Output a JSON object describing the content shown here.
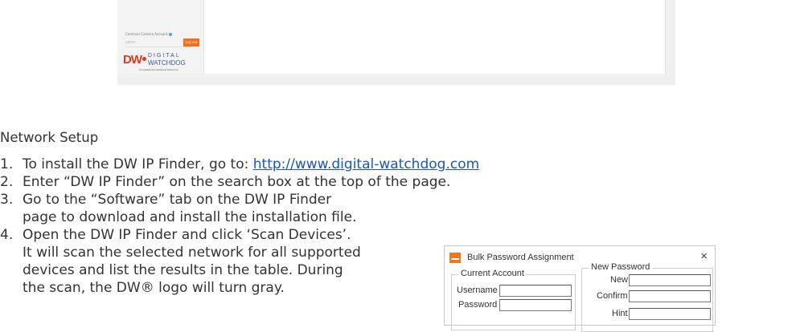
{
  "embedded_screenshot": {
    "common_camera_account_label": "Common Camera Account",
    "input_text": "admin",
    "button_label": "Log out",
    "logo": {
      "mark": "DW",
      "line1": "DIGITAL",
      "line2": "WATCHDOG",
      "tagline": "Complete Surveillance Solutions"
    }
  },
  "document": {
    "heading": "Network Setup",
    "steps": [
      {
        "num": "1.",
        "text": "To install the DW IP Finder, go to: ",
        "link": "http://www.digital-watchdog.com"
      },
      {
        "num": "2.",
        "text": "Enter “DW IP Finder” on the search box at the top of the page."
      },
      {
        "num": "3.",
        "lines": [
          "Go to the “Software” tab on the DW IP Finder",
          "page to download and install the installation file."
        ]
      },
      {
        "num": "4.",
        "lines": [
          "Open the DW IP Finder and click ‘Scan Devices’.",
          "It will scan the selected network for all supported",
          "devices and list the results in the table. During",
          "the scan, the DW® logo will turn gray."
        ]
      }
    ]
  },
  "dialog": {
    "title": "Bulk Password Assignment",
    "close_icon": "close-icon",
    "current_account": {
      "legend": "Current Account",
      "username_label": "Username",
      "password_label": "Password"
    },
    "new_password": {
      "legend": "New Password",
      "new_label": "New",
      "confirm_label": "Confirm",
      "hint_label": "Hint"
    },
    "accent_color": "#f07a1a"
  }
}
